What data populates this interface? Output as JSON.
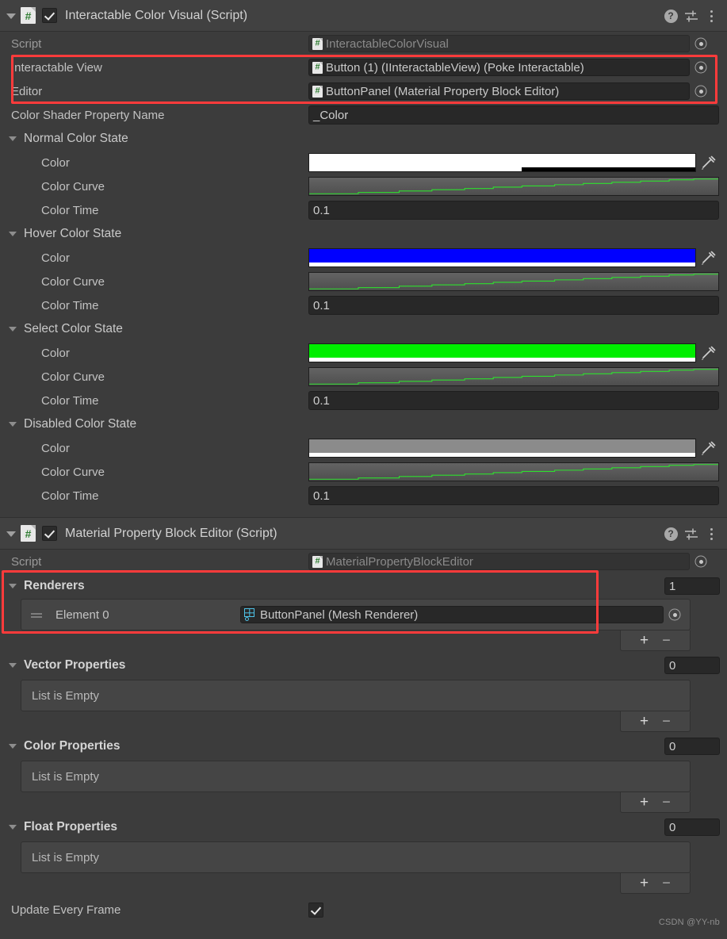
{
  "components": [
    {
      "title": "Interactable Color Visual (Script)",
      "enabled": true,
      "script_label": "Script",
      "script_value": "InteractableColorVisual",
      "fields": [
        {
          "label": "Interactable View",
          "value": "Button (1) (IInteractableView) (Poke Interactable)"
        },
        {
          "label": "Editor",
          "value": "ButtonPanel (Material Property Block Editor)"
        }
      ],
      "shader_prop_label": "Color Shader Property Name",
      "shader_prop_value": "_Color",
      "states": [
        {
          "title": "Normal Color State",
          "color_label": "Color",
          "color_hex": "#ffffff",
          "alpha": 0.55,
          "curve_label": "Color Curve",
          "time_label": "Color Time",
          "time_value": "0.1"
        },
        {
          "title": "Hover Color State",
          "color_label": "Color",
          "color_hex": "#0000ff",
          "alpha": 1.0,
          "curve_label": "Color Curve",
          "time_label": "Color Time",
          "time_value": "0.1"
        },
        {
          "title": "Select Color State",
          "color_label": "Color",
          "color_hex": "#00ee00",
          "alpha": 1.0,
          "curve_label": "Color Curve",
          "time_label": "Color Time",
          "time_value": "0.1"
        },
        {
          "title": "Disabled Color State",
          "color_label": "Color",
          "color_hex": "#8b8b8b",
          "alpha": 1.0,
          "curve_label": "Color Curve",
          "time_label": "Color Time",
          "time_value": "0.1"
        }
      ]
    },
    {
      "title": "Material Property Block Editor (Script)",
      "enabled": true,
      "script_label": "Script",
      "script_value": "MaterialPropertyBlockEditor",
      "renderers": {
        "title": "Renderers",
        "count": "1",
        "element_label": "Element 0",
        "element_value": "ButtonPanel (Mesh Renderer)",
        "add_label": "+",
        "remove_label": "−"
      },
      "lists": [
        {
          "title": "Vector Properties",
          "count": "0",
          "empty_text": "List is Empty",
          "add_label": "+",
          "remove_label": "−"
        },
        {
          "title": "Color Properties",
          "count": "0",
          "empty_text": "List is Empty",
          "add_label": "+",
          "remove_label": "−"
        },
        {
          "title": "Float Properties",
          "count": "0",
          "empty_text": "List is Empty",
          "add_label": "+",
          "remove_label": "−"
        }
      ],
      "update_every_frame": {
        "label": "Update Every Frame",
        "checked": true
      }
    }
  ],
  "curve_data": {
    "type": "line",
    "description": "Animation easing curve, stepped rising from 0 to 1",
    "points": [
      [
        0.0,
        0.02
      ],
      [
        0.12,
        0.02
      ],
      [
        0.12,
        0.1
      ],
      [
        0.22,
        0.1
      ],
      [
        0.22,
        0.2
      ],
      [
        0.3,
        0.2
      ],
      [
        0.3,
        0.28
      ],
      [
        0.38,
        0.28
      ],
      [
        0.38,
        0.36
      ],
      [
        0.45,
        0.36
      ],
      [
        0.45,
        0.45
      ],
      [
        0.52,
        0.45
      ],
      [
        0.52,
        0.53
      ],
      [
        0.6,
        0.53
      ],
      [
        0.6,
        0.61
      ],
      [
        0.67,
        0.61
      ],
      [
        0.67,
        0.69
      ],
      [
        0.74,
        0.69
      ],
      [
        0.74,
        0.77
      ],
      [
        0.81,
        0.77
      ],
      [
        0.81,
        0.85
      ],
      [
        0.88,
        0.85
      ],
      [
        0.88,
        0.93
      ],
      [
        0.94,
        0.93
      ],
      [
        0.94,
        0.98
      ],
      [
        1.0,
        0.98
      ]
    ],
    "line_color": "#2ee02e"
  },
  "watermark": "CSDN @YY-nb",
  "accent_highlight_color": "#ff3b3b"
}
